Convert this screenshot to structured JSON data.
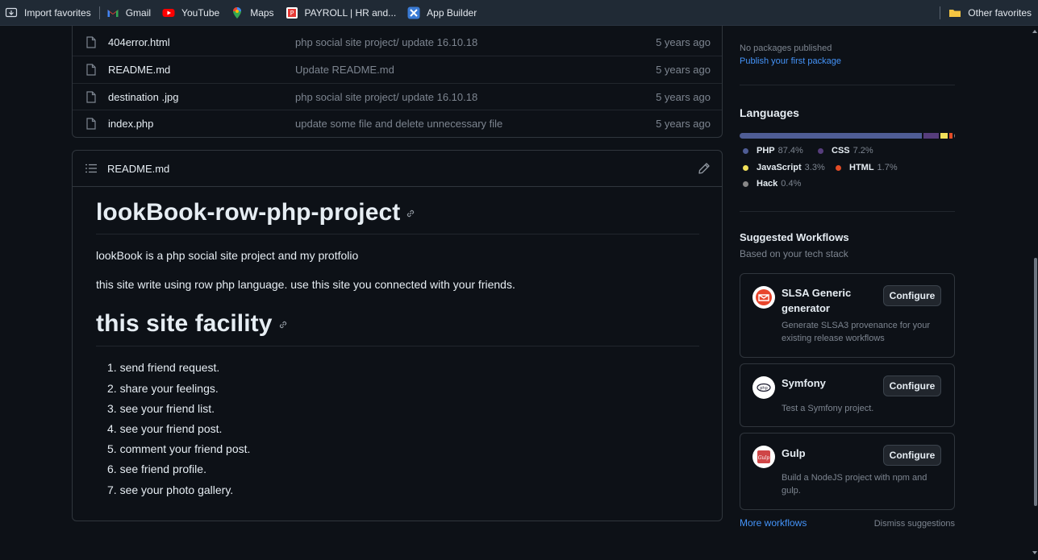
{
  "bookmarks": {
    "items": [
      {
        "label": "Import favorites",
        "icon": "import-favorites-icon"
      },
      {
        "label": "Gmail",
        "icon": "gmail-icon"
      },
      {
        "label": "YouTube",
        "icon": "youtube-icon"
      },
      {
        "label": "Maps",
        "icon": "maps-icon"
      },
      {
        "label": "PAYROLL | HR and...",
        "icon": "payroll-icon"
      },
      {
        "label": "App Builder",
        "icon": "app-builder-icon"
      }
    ],
    "other": "Other favorites"
  },
  "files": [
    {
      "name": "404error.html",
      "message": "php social site project/ update 16.10.18",
      "age": "5 years ago"
    },
    {
      "name": "README.md",
      "message": "Update README.md",
      "age": "5 years ago"
    },
    {
      "name": "destination .jpg",
      "message": "php social site project/ update 16.10.18",
      "age": "5 years ago"
    },
    {
      "name": "index.php",
      "message": "update some file and delete unnecessary file",
      "age": "5 years ago"
    }
  ],
  "readme": {
    "filename": "README.md",
    "title": "lookBook-row-php-project",
    "intro": "lookBook is a php social site project and my protfolio",
    "desc": "this site write using row php language. use this site you connected with your friends.",
    "facility_heading": "this site facility",
    "facilities": [
      "1. send friend request.",
      "2. share your feelings.",
      "3. see your friend list.",
      "4. see your friend post.",
      "5. comment your friend post.",
      "6. see friend profile.",
      "7. see your photo gallery."
    ]
  },
  "sidebar": {
    "packages": {
      "none": "No packages published",
      "publish_link": "Publish your first package"
    },
    "languages": {
      "title": "Languages",
      "items": [
        {
          "name": "PHP",
          "pct": "87.4%",
          "value": 87.4,
          "color": "#4F5D95"
        },
        {
          "name": "CSS",
          "pct": "7.2%",
          "value": 7.2,
          "color": "#563d7c"
        },
        {
          "name": "JavaScript",
          "pct": "3.3%",
          "value": 3.3,
          "color": "#f1e05a"
        },
        {
          "name": "HTML",
          "pct": "1.7%",
          "value": 1.7,
          "color": "#e34c26"
        },
        {
          "name": "Hack",
          "pct": "0.4%",
          "value": 0.4,
          "color": "#878787"
        }
      ]
    },
    "workflows": {
      "title": "Suggested Workflows",
      "subtitle": "Based on your tech stack",
      "cards": [
        {
          "name_line1": "SLSA Generic",
          "name_line2": "generator",
          "desc_line1": "Generate SLSA3 provenance for your",
          "desc_line2": "existing release workflows",
          "button": "Configure",
          "icon": "slsa-icon"
        },
        {
          "name_line1": "Symfony",
          "name_line2": "",
          "desc_line1": "Test a Symfony project.",
          "desc_line2": "",
          "button": "Configure",
          "icon": "symfony-icon"
        },
        {
          "name_line1": "Gulp",
          "name_line2": "",
          "desc_line1": "Build a NodeJS project with npm and",
          "desc_line2": "gulp.",
          "button": "Configure",
          "icon": "gulp-icon"
        }
      ],
      "more": "More workflows",
      "dismiss": "Dismiss suggestions"
    }
  }
}
